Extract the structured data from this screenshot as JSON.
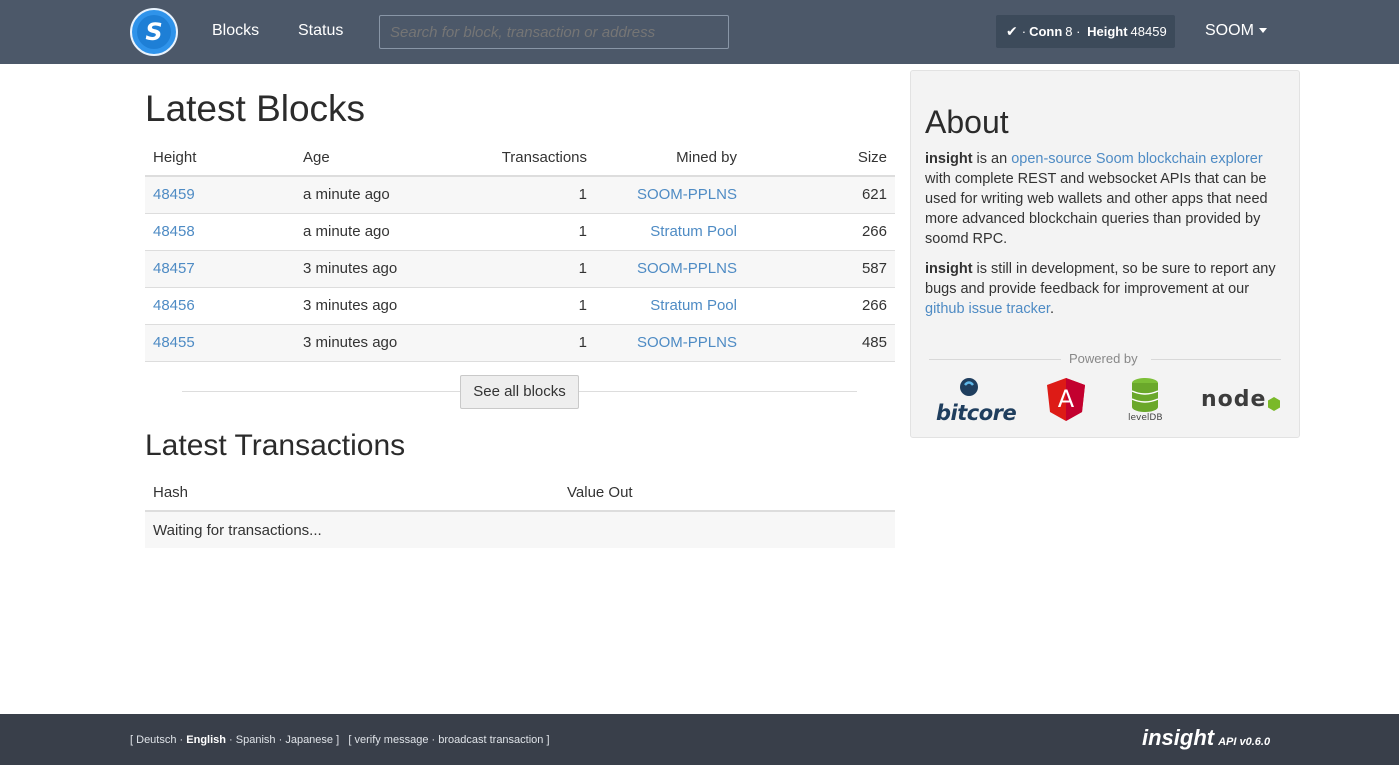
{
  "nav": {
    "logo_letter": "S",
    "links": [
      "Blocks",
      "Status"
    ],
    "search_placeholder": "Search for block, transaction or address",
    "conn": {
      "prefix": "· ",
      "conn_label": "Conn",
      "conn_value": "8",
      "sep": " · ",
      "height_label": "Height",
      "height_value": "48459"
    },
    "currency": "SOOM"
  },
  "blocks": {
    "title": "Latest Blocks",
    "headers": [
      "Height",
      "Age",
      "Transactions",
      "Mined by",
      "Size"
    ],
    "rows": [
      {
        "height": "48459",
        "age": "a minute ago",
        "transactions": "1",
        "miner": "SOOM-PPLNS",
        "size": "621"
      },
      {
        "height": "48458",
        "age": "a minute ago",
        "transactions": "1",
        "miner": "Stratum Pool",
        "size": "266"
      },
      {
        "height": "48457",
        "age": "3 minutes ago",
        "transactions": "1",
        "miner": "SOOM-PPLNS",
        "size": "587"
      },
      {
        "height": "48456",
        "age": "3 minutes ago",
        "transactions": "1",
        "miner": "Stratum Pool",
        "size": "266"
      },
      {
        "height": "48455",
        "age": "3 minutes ago",
        "transactions": "1",
        "miner": "SOOM-PPLNS",
        "size": "485"
      }
    ],
    "see_all_label": "See all blocks"
  },
  "transactions": {
    "title": "Latest Transactions",
    "headers": [
      "Hash",
      "Value Out"
    ],
    "waiting": "Waiting for transactions..."
  },
  "about": {
    "title": "About",
    "p1_strong": "insight",
    "p1_a": " is an ",
    "p1_link": "open-source Soom blockchain explorer",
    "p1_b": " with complete REST and websocket APIs that can be used for writing web wallets and other apps that need more advanced blockchain queries than provided by soomd RPC.",
    "p2_strong": "insight",
    "p2_a": " is still in development, so be sure to report any bugs and provide feedback for improvement at our ",
    "p2_link": "github issue tracker",
    "p2_b": ".",
    "powered_by": "Powered by",
    "logos": [
      {
        "label": "bitcore",
        "icon": "bitcore-logo"
      },
      {
        "label": "A",
        "icon": "angular-logo"
      },
      {
        "label": "levelDB",
        "icon": "leveldb-logo"
      },
      {
        "label": "node",
        "icon": "node-logo"
      }
    ]
  },
  "footer": {
    "lang_open": "[ ",
    "lang_de": "Deutsch",
    "lang_en": "English",
    "lang_es": "Spanish",
    "lang_ja": "Japanese",
    "lang_close": " ]",
    "tools_open": "[ ",
    "verify": "verify message",
    "broadcast": "broadcast transaction",
    "tools_close": " ]",
    "brand": "insight",
    "version": "API v0.6.0"
  },
  "colors": {
    "navbar": "#4c5869",
    "link": "#4e8bc4",
    "footer": "#393f4a",
    "badge": "#3c4a5a"
  }
}
